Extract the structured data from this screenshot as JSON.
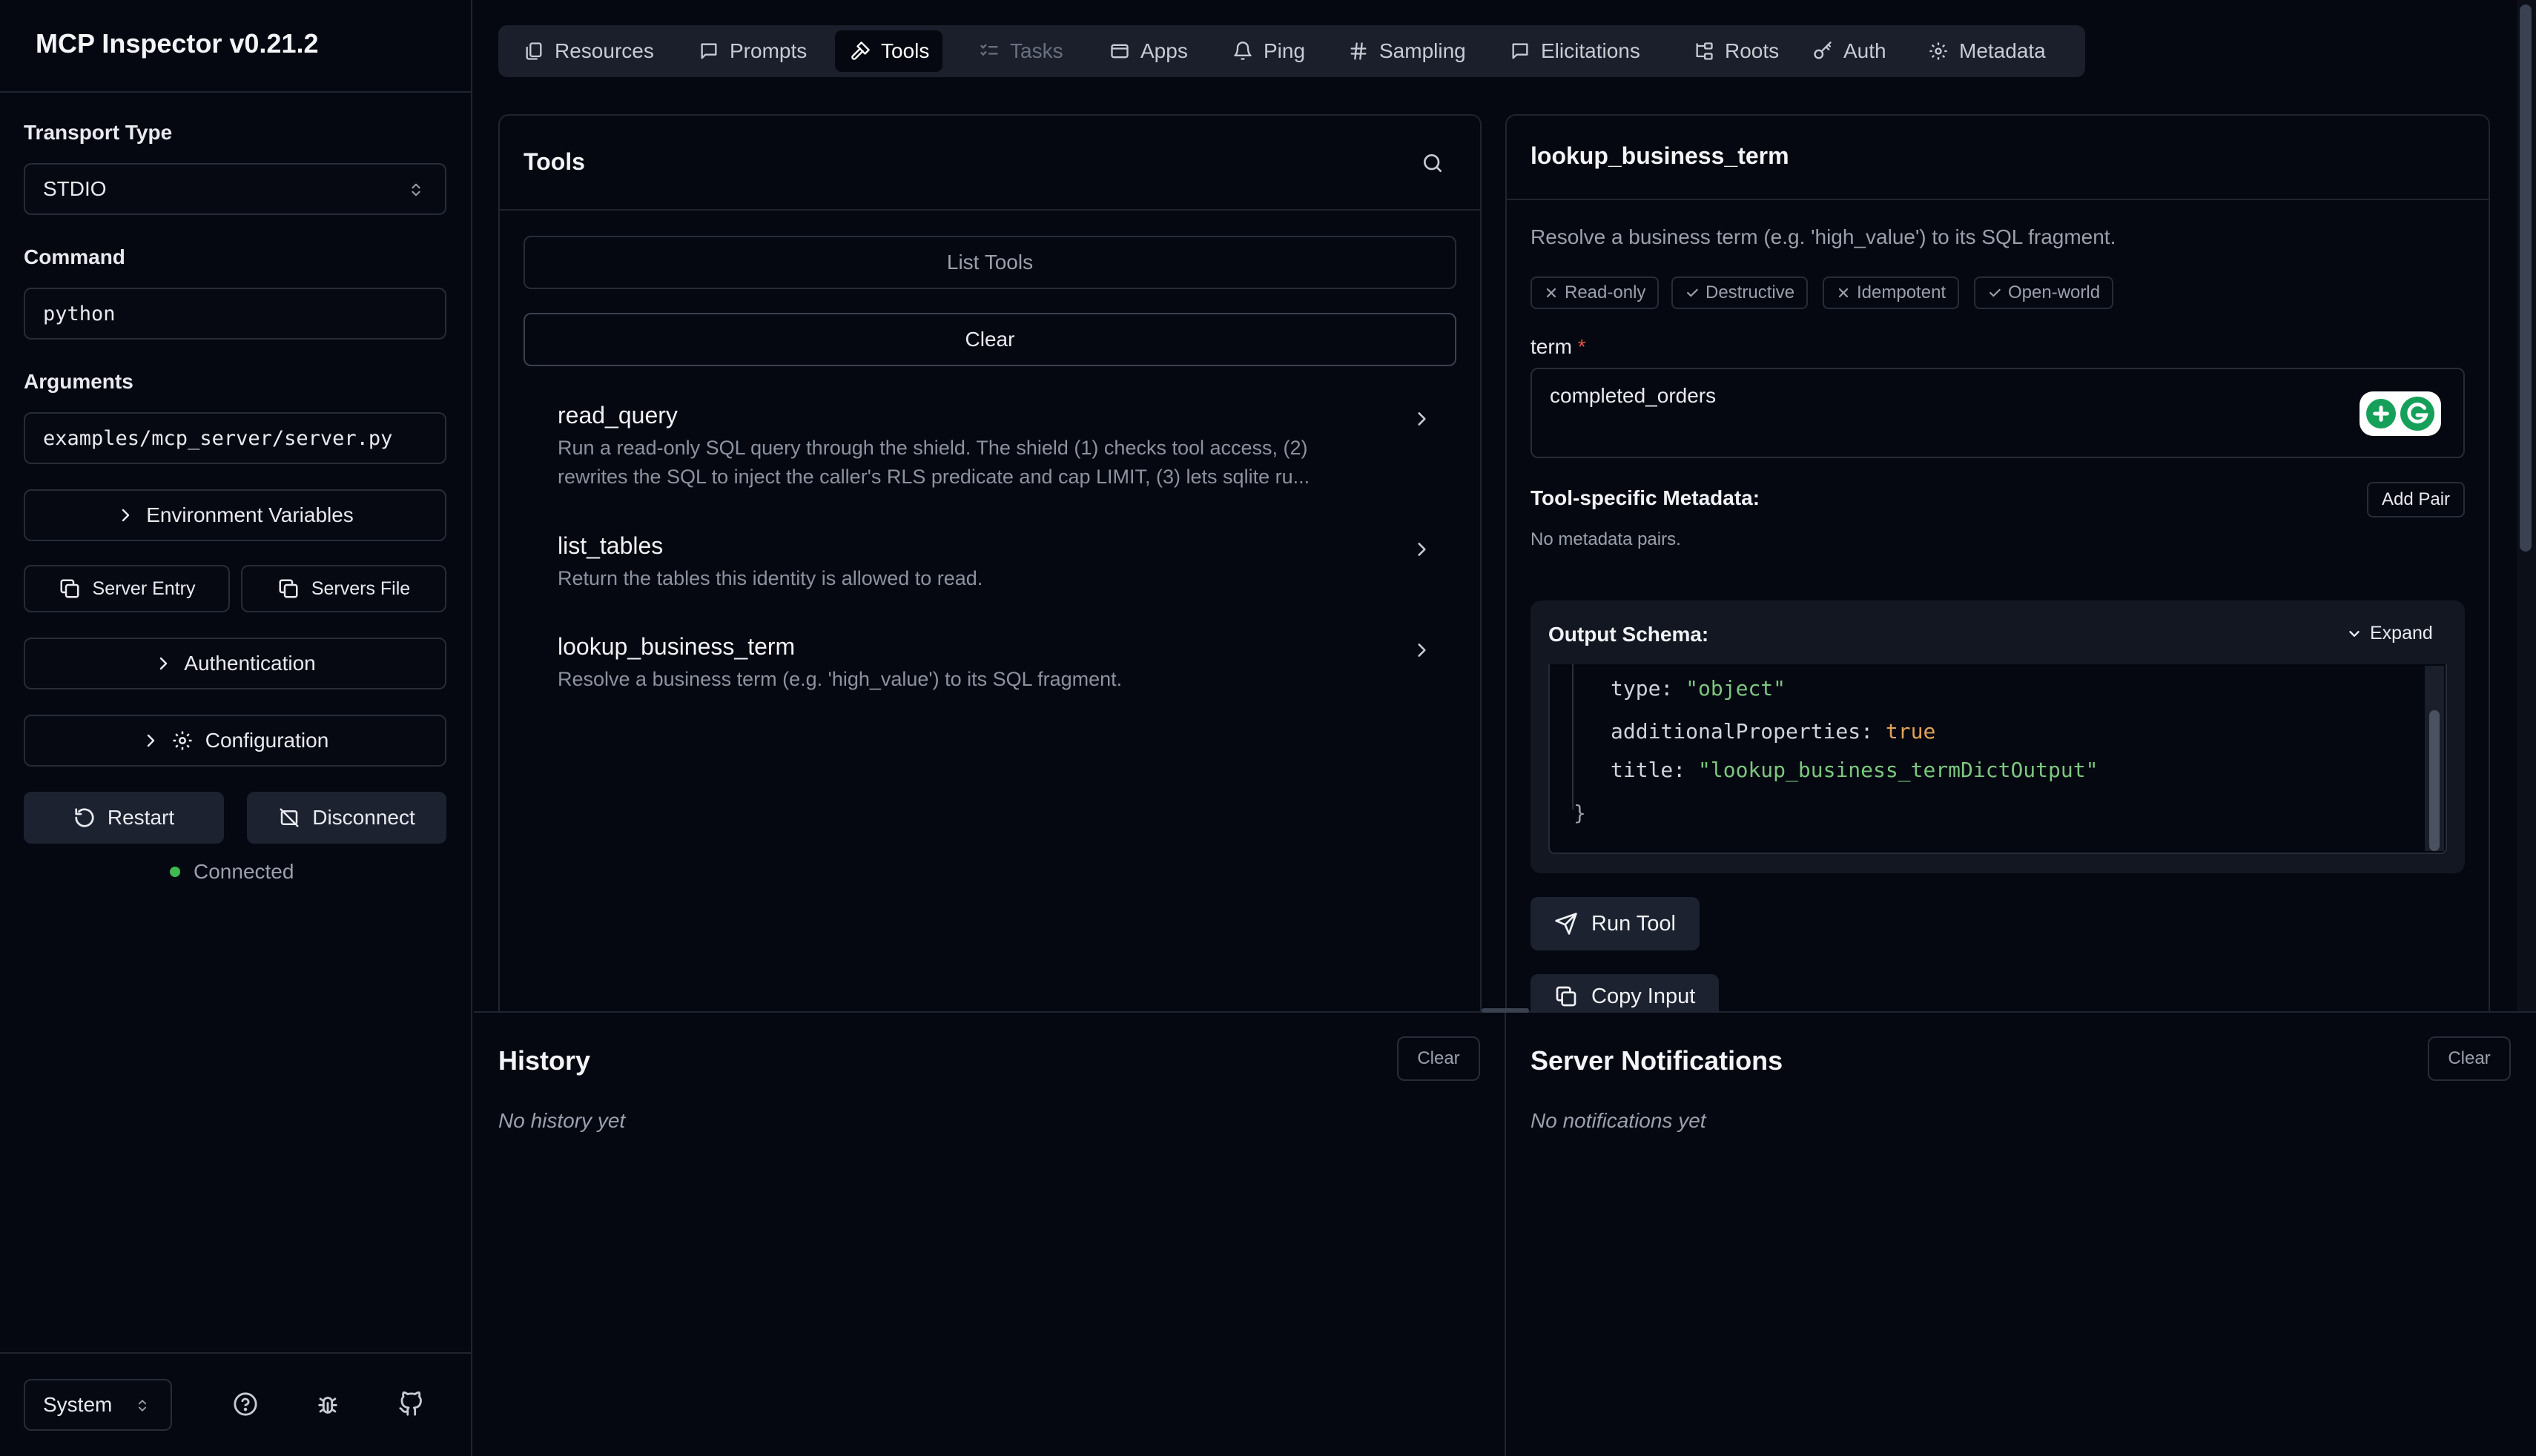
{
  "app": {
    "title": "MCP Inspector v0.21.2"
  },
  "sidebar": {
    "transport_label": "Transport Type",
    "transport_value": "STDIO",
    "command_label": "Command",
    "command_value": "python",
    "arguments_label": "Arguments",
    "arguments_value": "examples/mcp_server/server.py",
    "env_vars": "Environment Variables",
    "server_entry": "Server Entry",
    "servers_file": "Servers File",
    "authentication": "Authentication",
    "configuration": "Configuration",
    "restart": "Restart",
    "disconnect": "Disconnect",
    "status": "Connected",
    "status_color": "#3fb950",
    "theme": "System"
  },
  "tabs": [
    {
      "label": "Resources",
      "icon": "files-icon"
    },
    {
      "label": "Prompts",
      "icon": "message-icon"
    },
    {
      "label": "Tools",
      "icon": "hammer-icon",
      "active": true
    },
    {
      "label": "Tasks",
      "icon": "list-checks-icon",
      "disabled": true
    },
    {
      "label": "Apps",
      "icon": "app-window-icon"
    },
    {
      "label": "Ping",
      "icon": "bell-icon"
    },
    {
      "label": "Sampling",
      "icon": "hash-icon"
    },
    {
      "label": "Elicitations",
      "icon": "message-icon"
    },
    {
      "label": "Roots",
      "icon": "folder-tree-icon"
    },
    {
      "label": "Auth",
      "icon": "key-icon"
    },
    {
      "label": "Metadata",
      "icon": "gear-icon"
    }
  ],
  "tools_panel": {
    "title": "Tools",
    "list_button": "List Tools",
    "clear_button": "Clear",
    "items": [
      {
        "name": "read_query",
        "description_line1": "Run a read-only SQL query through the shield. The shield (1) checks tool access, (2)",
        "description_line2": "rewrites the SQL to inject the caller's RLS predicate and cap LIMIT, (3) lets sqlite ru..."
      },
      {
        "name": "list_tables",
        "description": "Return the tables this identity is allowed to read."
      },
      {
        "name": "lookup_business_term",
        "description": "Resolve a business term (e.g. 'high_value') to its SQL fragment."
      }
    ]
  },
  "detail_panel": {
    "title": "lookup_business_term",
    "description": "Resolve a business term (e.g. 'high_value') to its SQL fragment.",
    "badges": [
      {
        "label": "Read-only",
        "mark": "x"
      },
      {
        "label": "Destructive",
        "mark": "check"
      },
      {
        "label": "Idempotent",
        "mark": "x"
      },
      {
        "label": "Open-world",
        "mark": "check"
      }
    ],
    "term_label": "term",
    "required_mark": "*",
    "term_value": "completed_orders",
    "metadata_label": "Tool-specific Metadata:",
    "add_pair": "Add Pair",
    "no_metadata": "No metadata pairs.",
    "output_schema_label": "Output Schema:",
    "expand": "Expand",
    "schema": {
      "type_key": "type:",
      "type_val": "\"object\"",
      "addl_key": "additionalProperties:",
      "addl_val": "true",
      "title_key": "title:",
      "title_val": "\"lookup_business_termDictOutput\"",
      "close": "}"
    },
    "run_tool": "Run Tool",
    "copy_input": "Copy Input"
  },
  "history": {
    "title": "History",
    "clear": "Clear",
    "empty": "No history yet"
  },
  "notifications": {
    "title": "Server Notifications",
    "clear": "Clear",
    "empty": "No notifications yet"
  }
}
